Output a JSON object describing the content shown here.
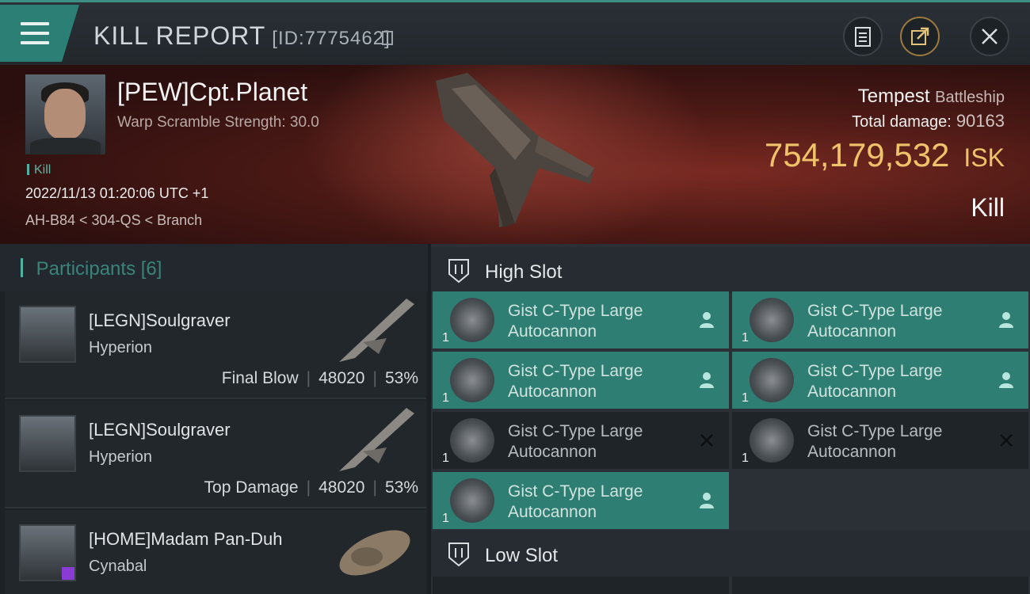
{
  "header": {
    "title": "KILL REPORT",
    "report_id": "[ID:7775462]"
  },
  "victim": {
    "pilot": "[PEW]Cpt.Planet",
    "warp_scramble": "Warp Scramble Strength: 30.0",
    "result_tag": "Kill",
    "datetime": "2022/11/13 01:20:06 UTC +1",
    "location": "AH-B84 < 304-QS < Branch",
    "ship_name": "Tempest",
    "ship_class": "Battleship",
    "total_damage_label": "Total damage:",
    "total_damage": "90163",
    "isk_value": "754,179,532",
    "isk_unit": "ISK",
    "result": "Kill"
  },
  "participants": {
    "title": "Participants",
    "count": "[6]",
    "items": [
      {
        "name": "[LEGN]Soulgraver",
        "ship": "Hyperion",
        "role": "Final Blow",
        "damage": "48020",
        "percent": "53%"
      },
      {
        "name": "[LEGN]Soulgraver",
        "ship": "Hyperion",
        "role": "Top Damage",
        "damage": "48020",
        "percent": "53%"
      },
      {
        "name": "[HOME]Madam Pan-Duh",
        "ship": "Cynabal",
        "role": "",
        "damage": "",
        "percent": ""
      }
    ]
  },
  "slots": {
    "high_label": "High Slot",
    "low_label": "Low Slot",
    "high_modules": [
      {
        "name_line1": "Gist C-Type Large",
        "name_line2": "Autocannon",
        "qty": "1",
        "status": "dropped-icon"
      },
      {
        "name_line1": "Gist C-Type Large",
        "name_line2": "Autocannon",
        "qty": "1",
        "status": "dropped-icon"
      },
      {
        "name_line1": "Gist C-Type Large",
        "name_line2": "Autocannon",
        "qty": "1",
        "status": "dropped-icon"
      },
      {
        "name_line1": "Gist C-Type Large",
        "name_line2": "Autocannon",
        "qty": "1",
        "status": "dropped-icon"
      },
      {
        "name_line1": "Gist C-Type Large",
        "name_line2": "Autocannon",
        "qty": "1",
        "status": "destroyed-icon"
      },
      {
        "name_line1": "Gist C-Type Large",
        "name_line2": "Autocannon",
        "qty": "1",
        "status": "destroyed-icon"
      },
      {
        "name_line1": "Gist C-Type Large",
        "name_line2": "Autocannon",
        "qty": "1",
        "status": "dropped-icon"
      }
    ]
  },
  "colors": {
    "accent": "#2c7f74",
    "isk": "#f0c36b"
  }
}
